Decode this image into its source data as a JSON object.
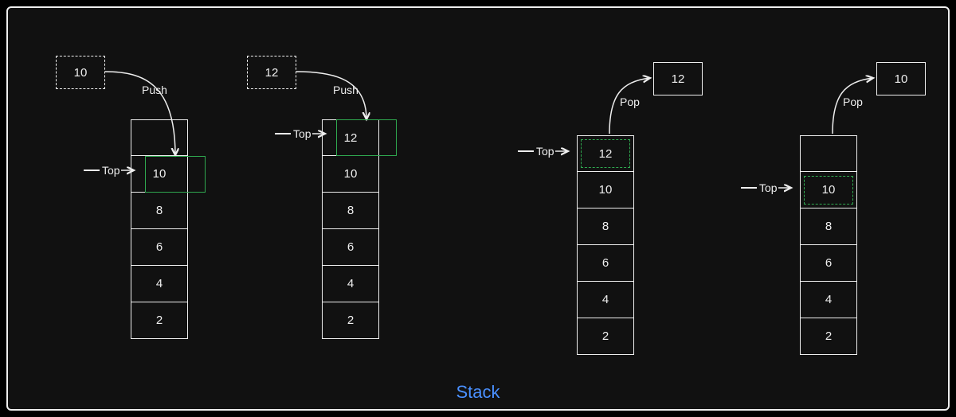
{
  "title": "Stack",
  "labels": {
    "top": "Top",
    "push": "Push",
    "pop": "Pop"
  },
  "columns": [
    {
      "id": "push1",
      "operation": "Push",
      "floating": {
        "value": "10",
        "style": "dashed"
      },
      "top_pointer_index": 1,
      "highlight": {
        "kind": "solid-green",
        "index": 1
      },
      "cells": [
        "",
        "10",
        "8",
        "6",
        "4",
        "2"
      ]
    },
    {
      "id": "push2",
      "operation": "Push",
      "floating": {
        "value": "12",
        "style": "dashed"
      },
      "top_pointer_index": 0,
      "highlight": {
        "kind": "solid-green",
        "index": 0
      },
      "cells": [
        "12",
        "10",
        "8",
        "6",
        "4",
        "2"
      ]
    },
    {
      "id": "pop1",
      "operation": "Pop",
      "floating": {
        "value": "12",
        "style": "solid"
      },
      "top_pointer_index": 0,
      "highlight": {
        "kind": "dashed-green",
        "index": 0
      },
      "cells": [
        "12",
        "10",
        "8",
        "6",
        "4",
        "2"
      ]
    },
    {
      "id": "pop2",
      "operation": "Pop",
      "floating": {
        "value": "10",
        "style": "solid"
      },
      "top_pointer_index": 1,
      "highlight": {
        "kind": "dashed-green",
        "index": 1
      },
      "cells": [
        "",
        "10",
        "8",
        "6",
        "4",
        "2"
      ]
    }
  ],
  "colors": {
    "accent_green": "#2fa84f",
    "title_blue": "#4a90ff"
  }
}
